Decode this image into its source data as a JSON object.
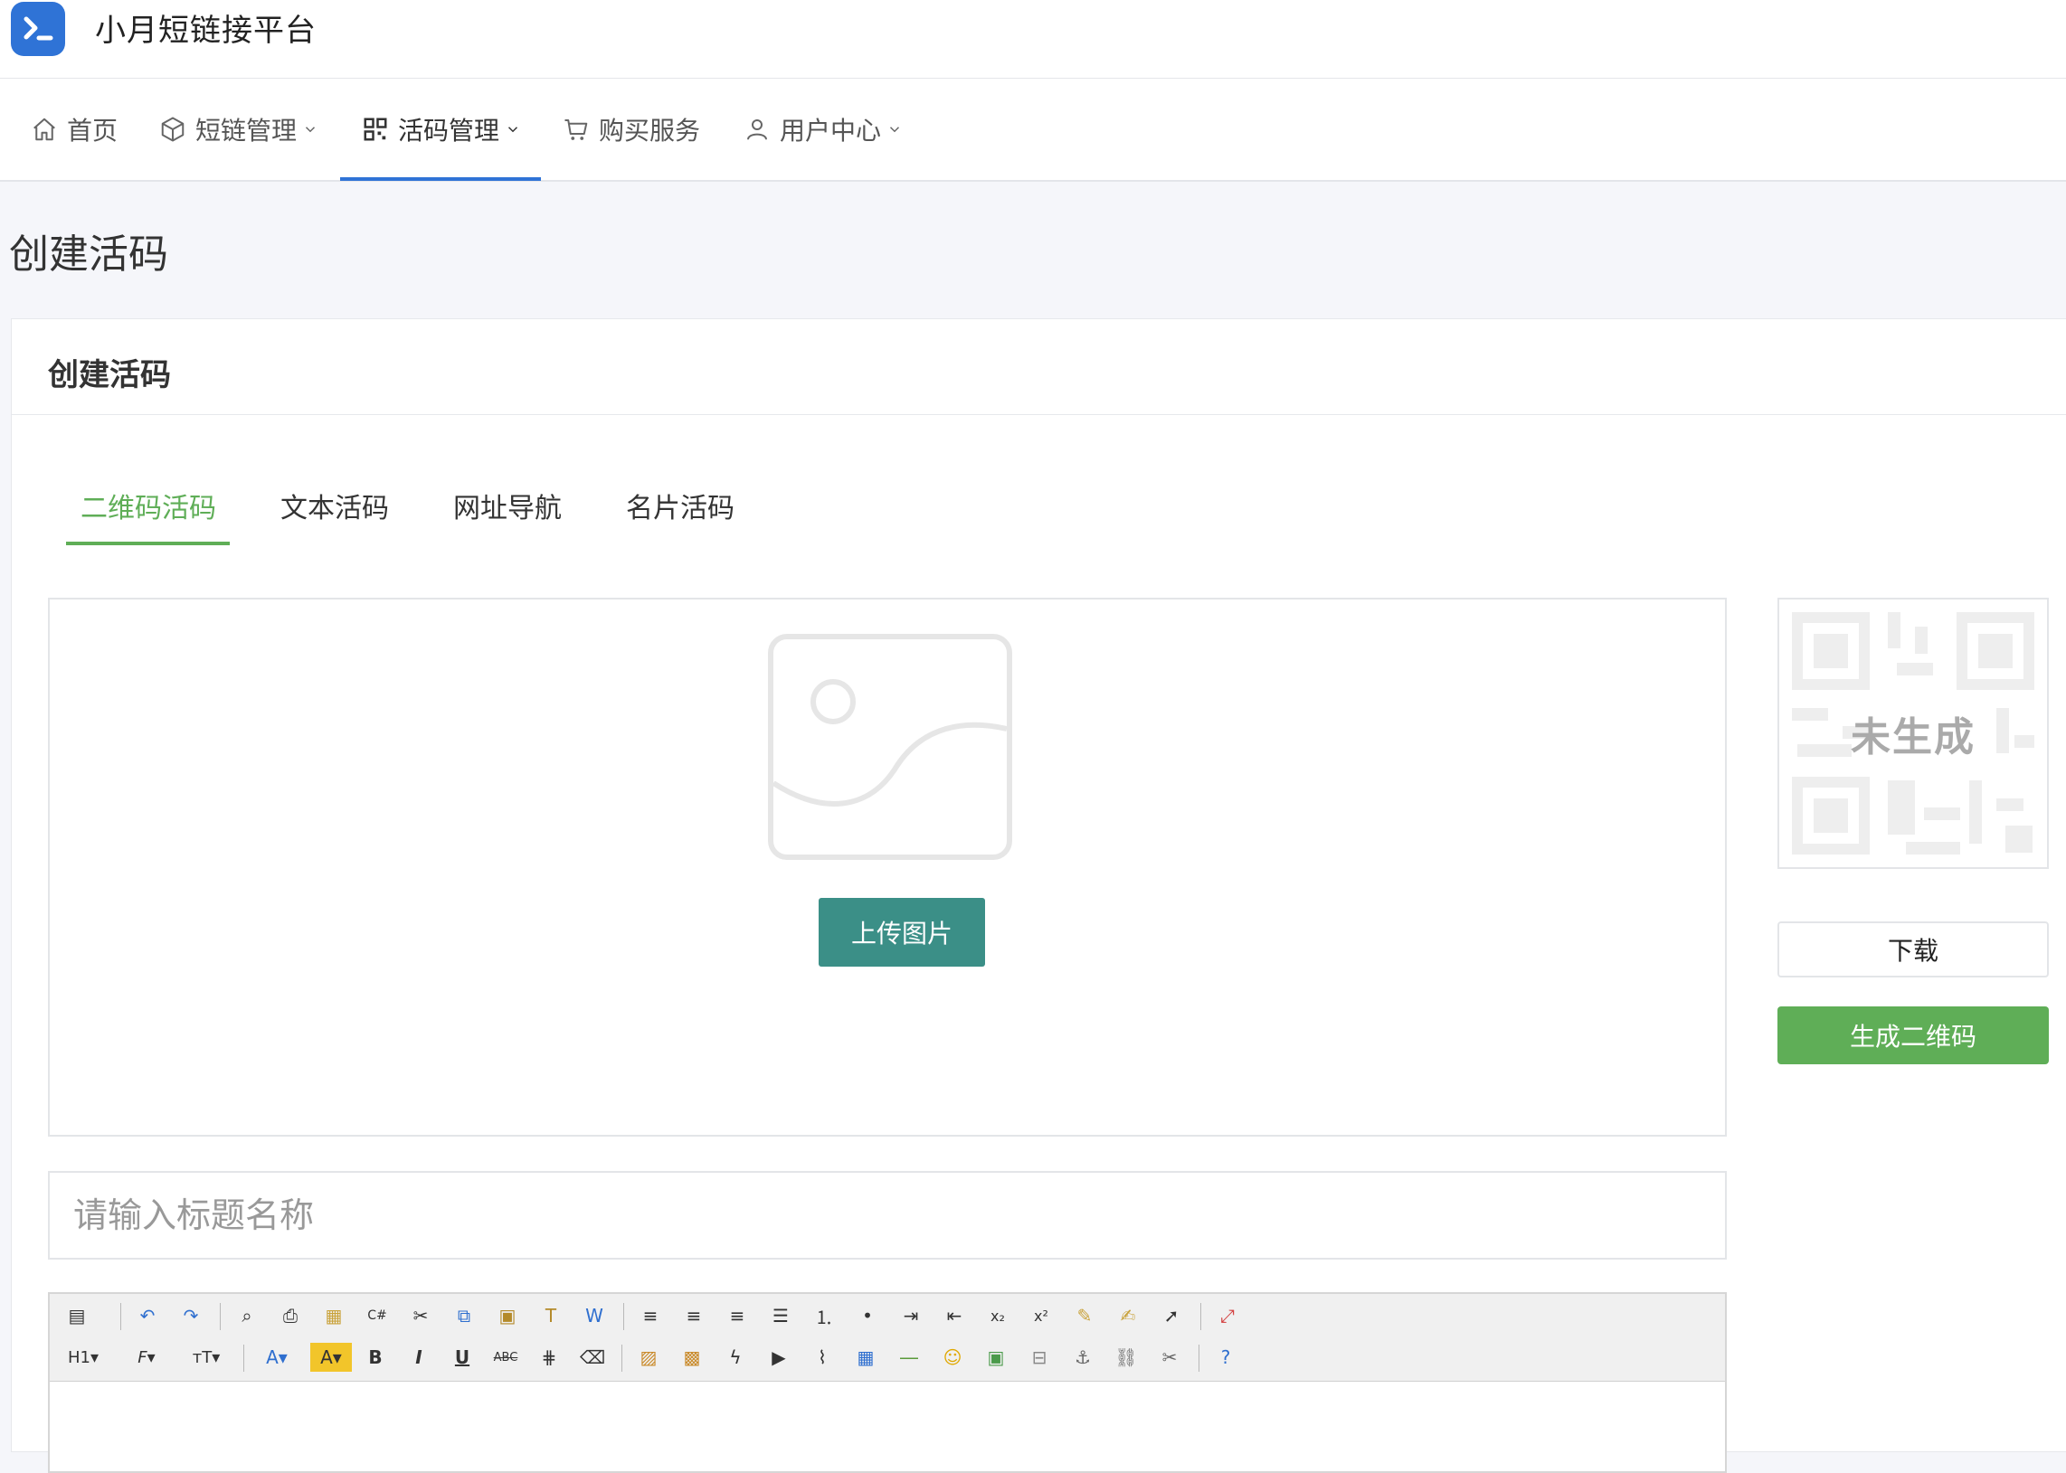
{
  "app": {
    "title": "小月短链接平台"
  },
  "nav": {
    "items": [
      {
        "label": "首页",
        "icon": "home-icon"
      },
      {
        "label": "短链管理",
        "icon": "cube-icon",
        "dropdown": true
      },
      {
        "label": "活码管理",
        "icon": "qrcode-icon",
        "dropdown": true,
        "active": true
      },
      {
        "label": "购买服务",
        "icon": "cart-icon"
      },
      {
        "label": "用户中心",
        "icon": "user-icon",
        "dropdown": true
      }
    ],
    "accent": "#2f73d6"
  },
  "page": {
    "title": "创建活码"
  },
  "card": {
    "title": "创建活码",
    "tabs": [
      {
        "label": "二维码活码",
        "active": true
      },
      {
        "label": "文本活码"
      },
      {
        "label": "网址导航"
      },
      {
        "label": "名片活码"
      }
    ],
    "tab_accent": "#5fae57"
  },
  "upload": {
    "button_label": "上传图片",
    "button_color": "#3b8f87"
  },
  "title_input": {
    "value": "",
    "placeholder": "请输入标题名称"
  },
  "qr": {
    "status_text": "未生成"
  },
  "actions": {
    "download_label": "下载",
    "generate_label": "生成二维码",
    "generate_color": "#5fae57"
  },
  "editor": {
    "toolbar_row1": [
      "source-icon",
      "undo-icon",
      "redo-icon",
      "preview-icon",
      "print-icon",
      "template-icon",
      "code-icon",
      "cut-icon",
      "copy-icon",
      "paste-icon",
      "paste-text-icon",
      "paste-word-icon",
      "align-left-icon",
      "align-center-icon",
      "align-right-icon",
      "align-justify-icon",
      "ordered-list-icon",
      "unordered-list-icon",
      "indent-icon",
      "outdent-icon",
      "subscript-icon",
      "superscript-icon",
      "clear-format-icon",
      "select-all-icon",
      "pointer-icon",
      "fullscreen-icon"
    ],
    "toolbar_row2": [
      "heading-icon",
      "font-family-icon",
      "font-size-icon",
      "font-color-icon",
      "highlight-icon",
      "bold-icon",
      "italic-icon",
      "underline-icon",
      "strikethrough-icon",
      "line-height-icon",
      "eraser-icon",
      "insert-image-icon",
      "multi-image-icon",
      "flash-icon",
      "media-icon",
      "attachment-icon",
      "table-icon",
      "horizontal-rule-icon",
      "emoticon-icon",
      "image-icon",
      "page-break-icon",
      "anchor-icon",
      "link-icon",
      "unlink-icon",
      "help-icon"
    ]
  }
}
